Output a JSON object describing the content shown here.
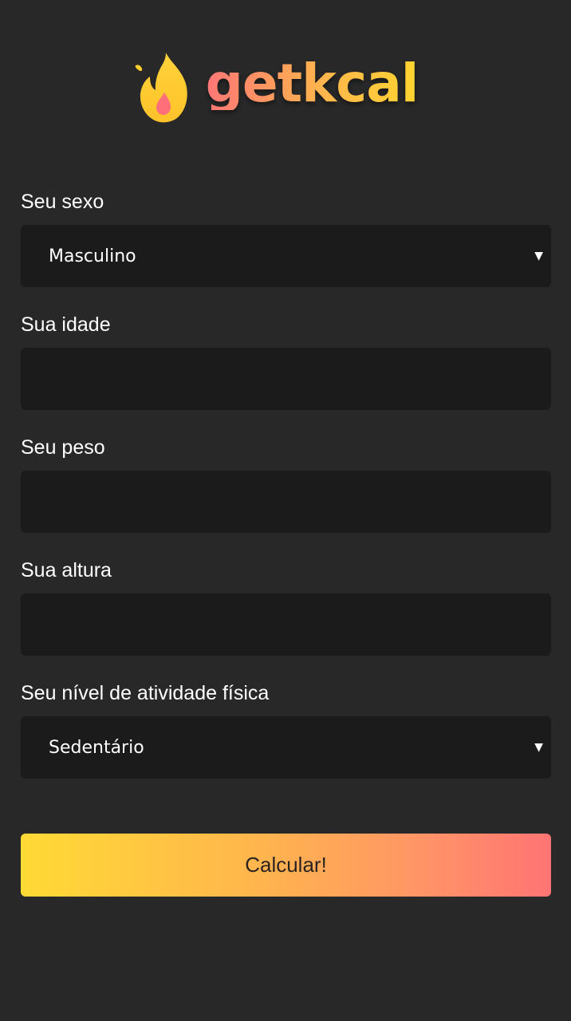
{
  "header": {
    "logo_text": "getkcal",
    "logo_icon": "flame-icon"
  },
  "form": {
    "sex": {
      "label": "Seu sexo",
      "selected": "Masculino"
    },
    "age": {
      "label": "Sua idade",
      "value": ""
    },
    "weight": {
      "label": "Seu peso",
      "value": ""
    },
    "height": {
      "label": "Sua altura",
      "value": ""
    },
    "activity": {
      "label": "Seu nível de atividade física",
      "selected": "Sedentário"
    },
    "submit_label": "Calcular!"
  },
  "colors": {
    "background": "#282828",
    "field_background": "#1b1b1b",
    "gradient_start": "#ffda35",
    "gradient_end": "#ff7474"
  }
}
